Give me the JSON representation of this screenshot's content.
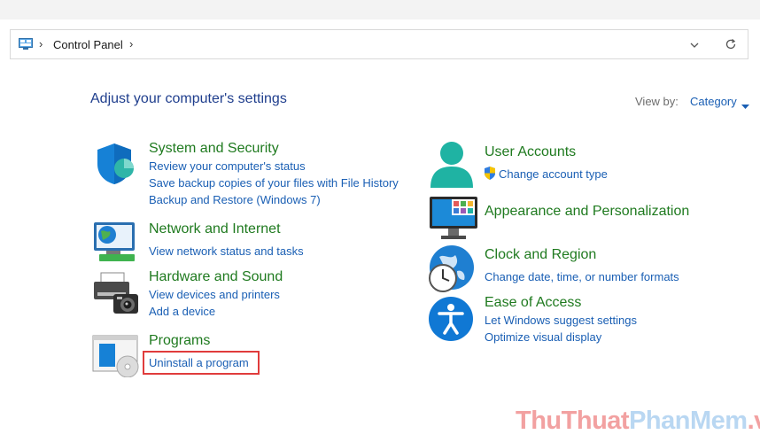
{
  "address_bar": {
    "breadcrumb": "Control Panel"
  },
  "header": {
    "title": "Adjust your computer's settings",
    "view_by_label": "View by:",
    "view_by_value": "Category"
  },
  "categories_left": [
    {
      "title": "System and Security",
      "links": [
        "Review your computer's status",
        "Save backup copies of your files with File History",
        "Backup and Restore (Windows 7)"
      ]
    },
    {
      "title": "Network and Internet",
      "links": [
        "View network status and tasks"
      ]
    },
    {
      "title": "Hardware and Sound",
      "links": [
        "View devices and printers",
        "Add a device"
      ]
    },
    {
      "title": "Programs",
      "links": [
        "Uninstall a program"
      ]
    }
  ],
  "categories_right": [
    {
      "title": "User Accounts",
      "links": [
        "Change account type"
      ]
    },
    {
      "title": "Appearance and Personalization",
      "links": []
    },
    {
      "title": "Clock and Region",
      "links": [
        "Change date, time, or number formats"
      ]
    },
    {
      "title": "Ease of Access",
      "links": [
        "Let Windows suggest settings",
        "Optimize visual display"
      ]
    }
  ],
  "watermark": {
    "part1": "ThuThuat",
    "part2": "PhanMem",
    "part3": ".vn"
  },
  "colors": {
    "category_title": "#1f7a1f",
    "link": "#1a5fb4",
    "heading": "#1f3e8d",
    "highlight": "#e03c3c"
  }
}
